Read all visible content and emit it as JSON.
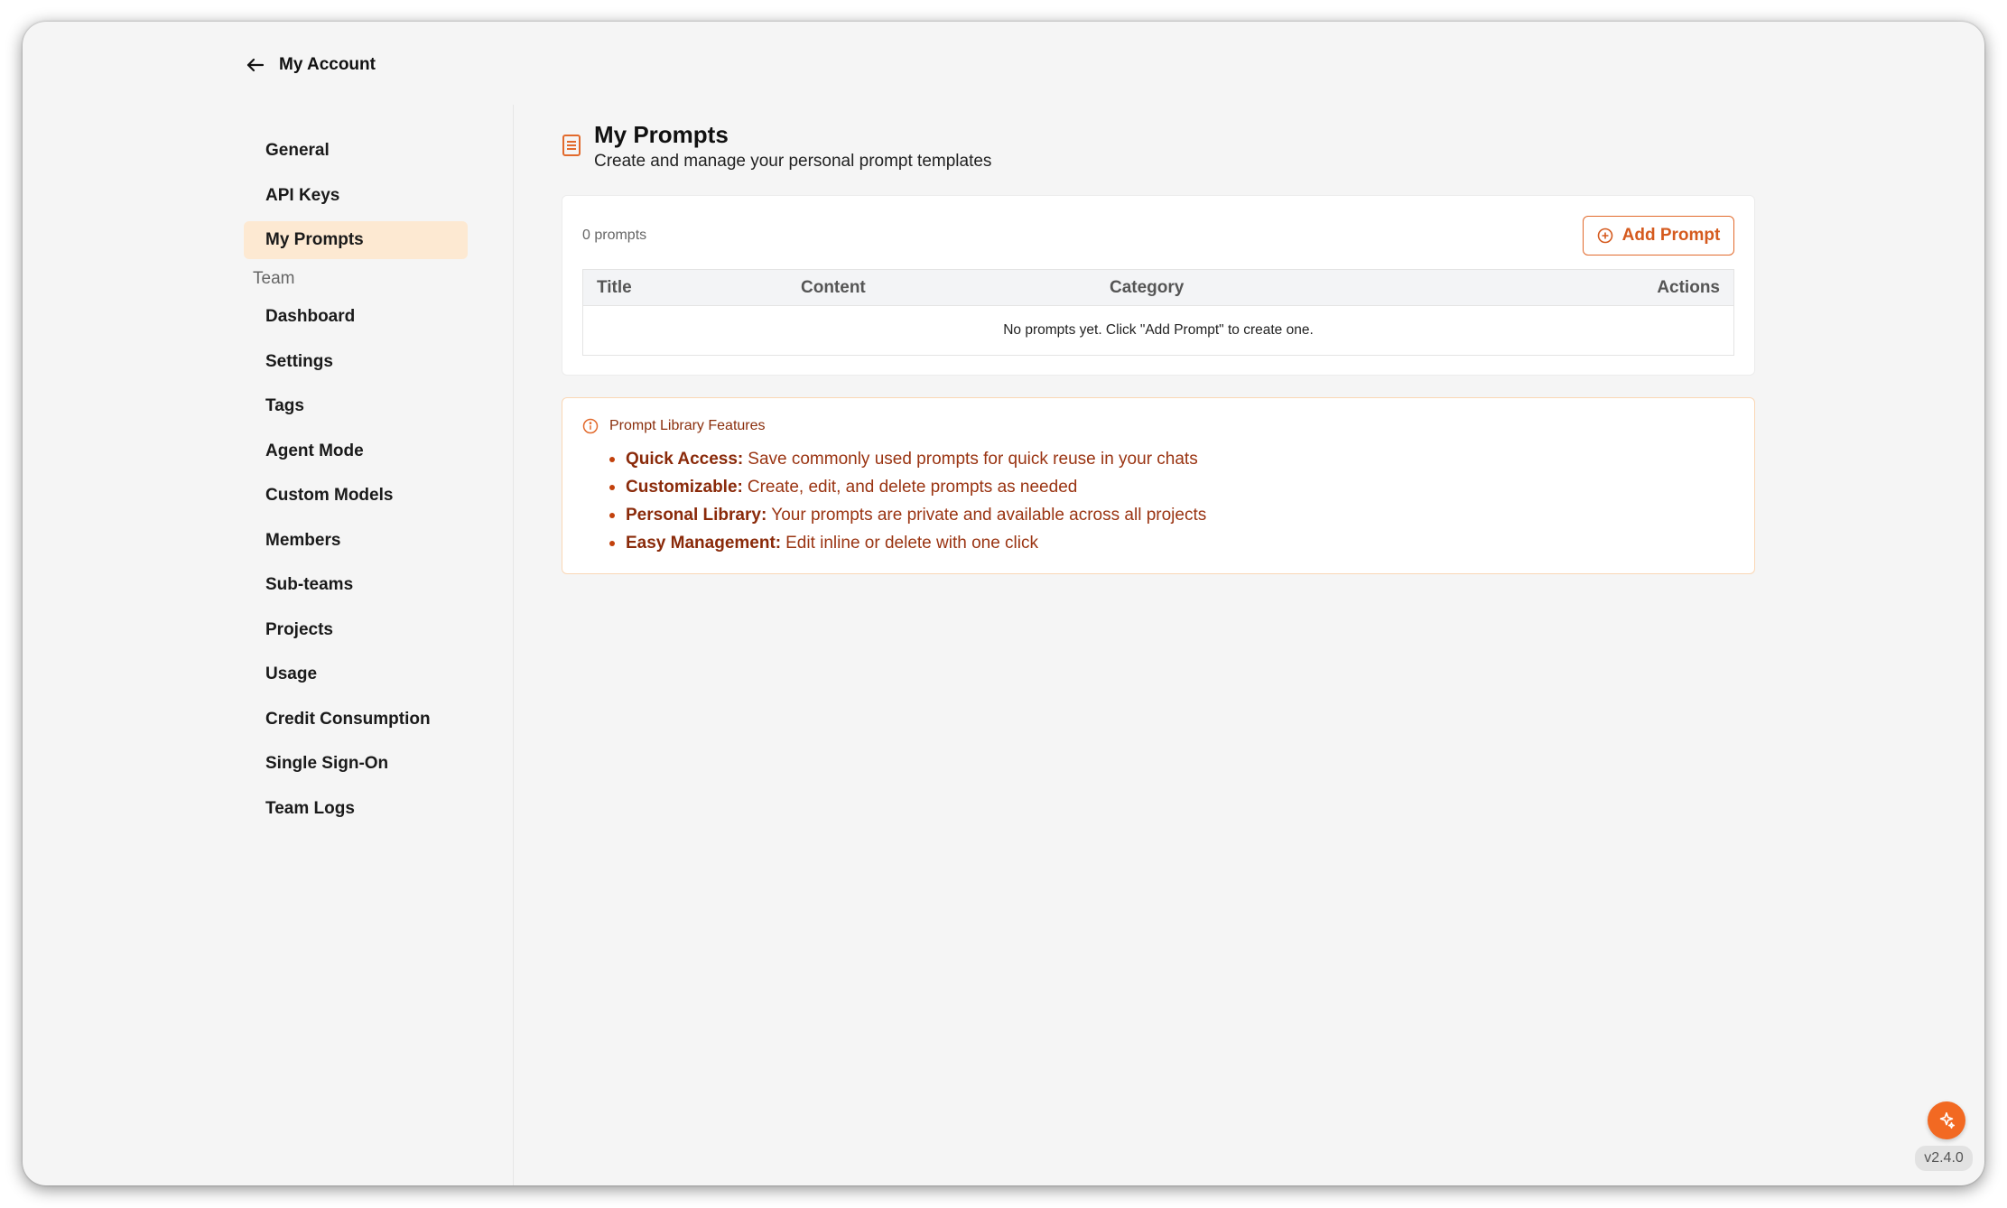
{
  "header": {
    "back_label": "My Account"
  },
  "sidebar": {
    "account_items": [
      {
        "label": "General"
      },
      {
        "label": "API Keys"
      },
      {
        "label": "My Prompts",
        "active": true
      }
    ],
    "team_section_label": "Team",
    "team_items": [
      {
        "label": "Dashboard"
      },
      {
        "label": "Settings"
      },
      {
        "label": "Tags"
      },
      {
        "label": "Agent Mode"
      },
      {
        "label": "Custom Models"
      },
      {
        "label": "Members"
      },
      {
        "label": "Sub-teams"
      },
      {
        "label": "Projects"
      },
      {
        "label": "Usage"
      },
      {
        "label": "Credit Consumption"
      },
      {
        "label": "Single Sign-On"
      },
      {
        "label": "Team Logs"
      }
    ]
  },
  "main": {
    "title": "My Prompts",
    "subtitle": "Create and manage your personal prompt templates",
    "prompt_count": "0 prompts",
    "add_button_label": "Add Prompt",
    "table": {
      "columns": [
        "Title",
        "Content",
        "Category",
        "Actions"
      ],
      "empty_message": "No prompts yet. Click \"Add Prompt\" to create one."
    },
    "features": {
      "heading": "Prompt Library Features",
      "items": [
        {
          "name": "Quick Access:",
          "description": "Save commonly used prompts for quick reuse in your chats"
        },
        {
          "name": "Customizable:",
          "description": "Create, edit, and delete prompts as needed"
        },
        {
          "name": "Personal Library:",
          "description": "Your prompts are private and available across all projects"
        },
        {
          "name": "Easy Management:",
          "description": "Edit inline or delete with one click"
        }
      ]
    }
  },
  "footer": {
    "version": "v2.4.0"
  },
  "colors": {
    "accent": "#f26922",
    "active_nav_bg": "#fde9d2",
    "feature_text": "#9a3412",
    "window_bg": "#f5f5f5"
  },
  "icons": {
    "back": "arrow-left-icon",
    "page": "document-icon",
    "add": "plus-circle-icon",
    "info": "info-circle-icon",
    "fab": "sparkles-icon"
  }
}
